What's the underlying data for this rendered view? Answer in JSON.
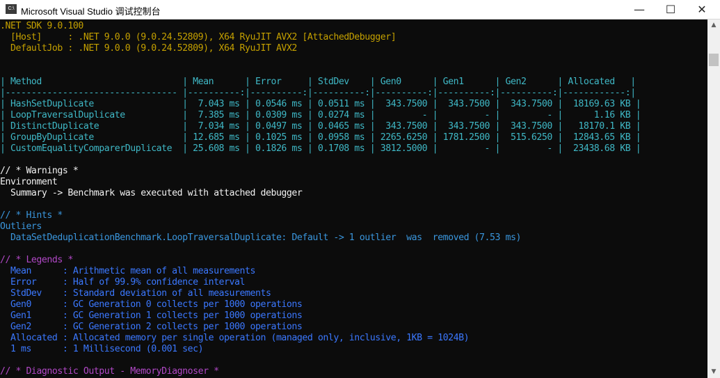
{
  "window": {
    "icon_text": "C:\\",
    "title": "Microsoft Visual Studio 调试控制台",
    "minimize": "—",
    "maximize": "☐",
    "close": "✕"
  },
  "console": {
    "sdk": ".NET SDK 9.0.100",
    "host": "  [Host]     : .NET 9.0.0 (9.0.24.52809), X64 RyuJIT AVX2 [AttachedDebugger]",
    "defaultjob": "  DefaultJob : .NET 9.0.0 (9.0.24.52809), X64 RyuJIT AVX2",
    "table_header": "| Method                           | Mean      | Error     | StdDev    | Gen0      | Gen1      | Gen2      | Allocated   |",
    "table_separator": "|--------------------------------- |----------:|----------:|----------:|----------:|----------:|----------:|------------:|",
    "table_rows": [
      "| HashSetDuplicate                 |  7.043 ms | 0.0546 ms | 0.0511 ms |  343.7500 |  343.7500 |  343.7500 |  18169.63 KB |",
      "| LoopTraversalDuplicate           |  7.385 ms | 0.0309 ms | 0.0274 ms |         - |         - |         - |      1.16 KB |",
      "| DistinctDuplicate                |  7.034 ms | 0.0497 ms | 0.0465 ms |  343.7500 |  343.7500 |  343.7500 |   18170.1 KB |",
      "| GroupByDuplicate                 | 12.685 ms | 0.1025 ms | 0.0958 ms | 2265.6250 | 1781.2500 |  515.6250 |  12843.65 KB |",
      "| CustomEqualityComparerDuplicate  | 25.608 ms | 0.1826 ms | 0.1708 ms | 3812.5000 |         - |         - |  23438.68 KB |"
    ],
    "warnings_header": "// * Warnings *",
    "environment": "Environment",
    "summary": "  Summary -> Benchmark was executed with attached debugger",
    "hints_header": "// * Hints *",
    "outliers": "Outliers",
    "outlier_detail": "  DataSetDeduplicationBenchmark.LoopTraversalDuplicate: Default -> 1 outlier  was  removed (7.53 ms)",
    "legends_header": "// * Legends *",
    "legends": [
      "  Mean      : Arithmetic mean of all measurements",
      "  Error     : Half of 99.9% confidence interval",
      "  StdDev    : Standard deviation of all measurements",
      "  Gen0      : GC Generation 0 collects per 1000 operations",
      "  Gen1      : GC Generation 1 collects per 1000 operations",
      "  Gen2      : GC Generation 2 collects per 1000 operations",
      "  Allocated : Allocated memory per single operation (managed only, inclusive, 1KB = 1024B)",
      "  1 ms      : 1 Millisecond (0.001 sec)"
    ],
    "diagnostic_header": "// * Diagnostic Output - MemoryDiagnoser *"
  },
  "scrollbar": {
    "up_arrow": "▲",
    "down_arrow": "▼"
  },
  "colors": {
    "background": "#0c0c0c",
    "yellow": "#c4a000",
    "cyan": "#3a96dd",
    "magenta": "#b148c6",
    "text": "#cccccc"
  }
}
